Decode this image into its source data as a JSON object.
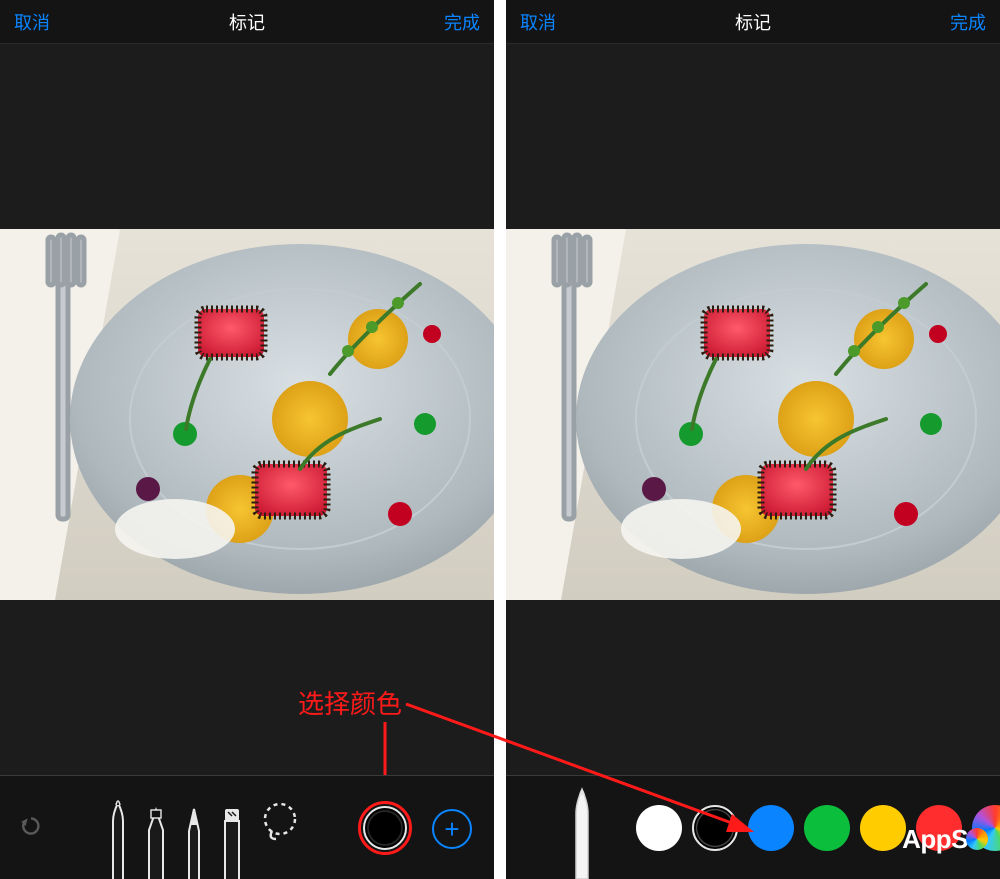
{
  "header": {
    "cancel": "取消",
    "title": "标记",
    "done": "完成"
  },
  "annotation": {
    "label": "选择颜色"
  },
  "left_toolbar": {
    "tools": [
      "marker",
      "highlighter",
      "pencil",
      "eraser",
      "lasso"
    ],
    "selected_color": "black",
    "undo_enabled": false,
    "add_shape": "+"
  },
  "right_palette": {
    "pen": "marker",
    "colors": [
      "white",
      "black",
      "blue",
      "green",
      "yellow",
      "red",
      "rainbow"
    ],
    "selected": "black"
  },
  "watermark": "AppSo"
}
